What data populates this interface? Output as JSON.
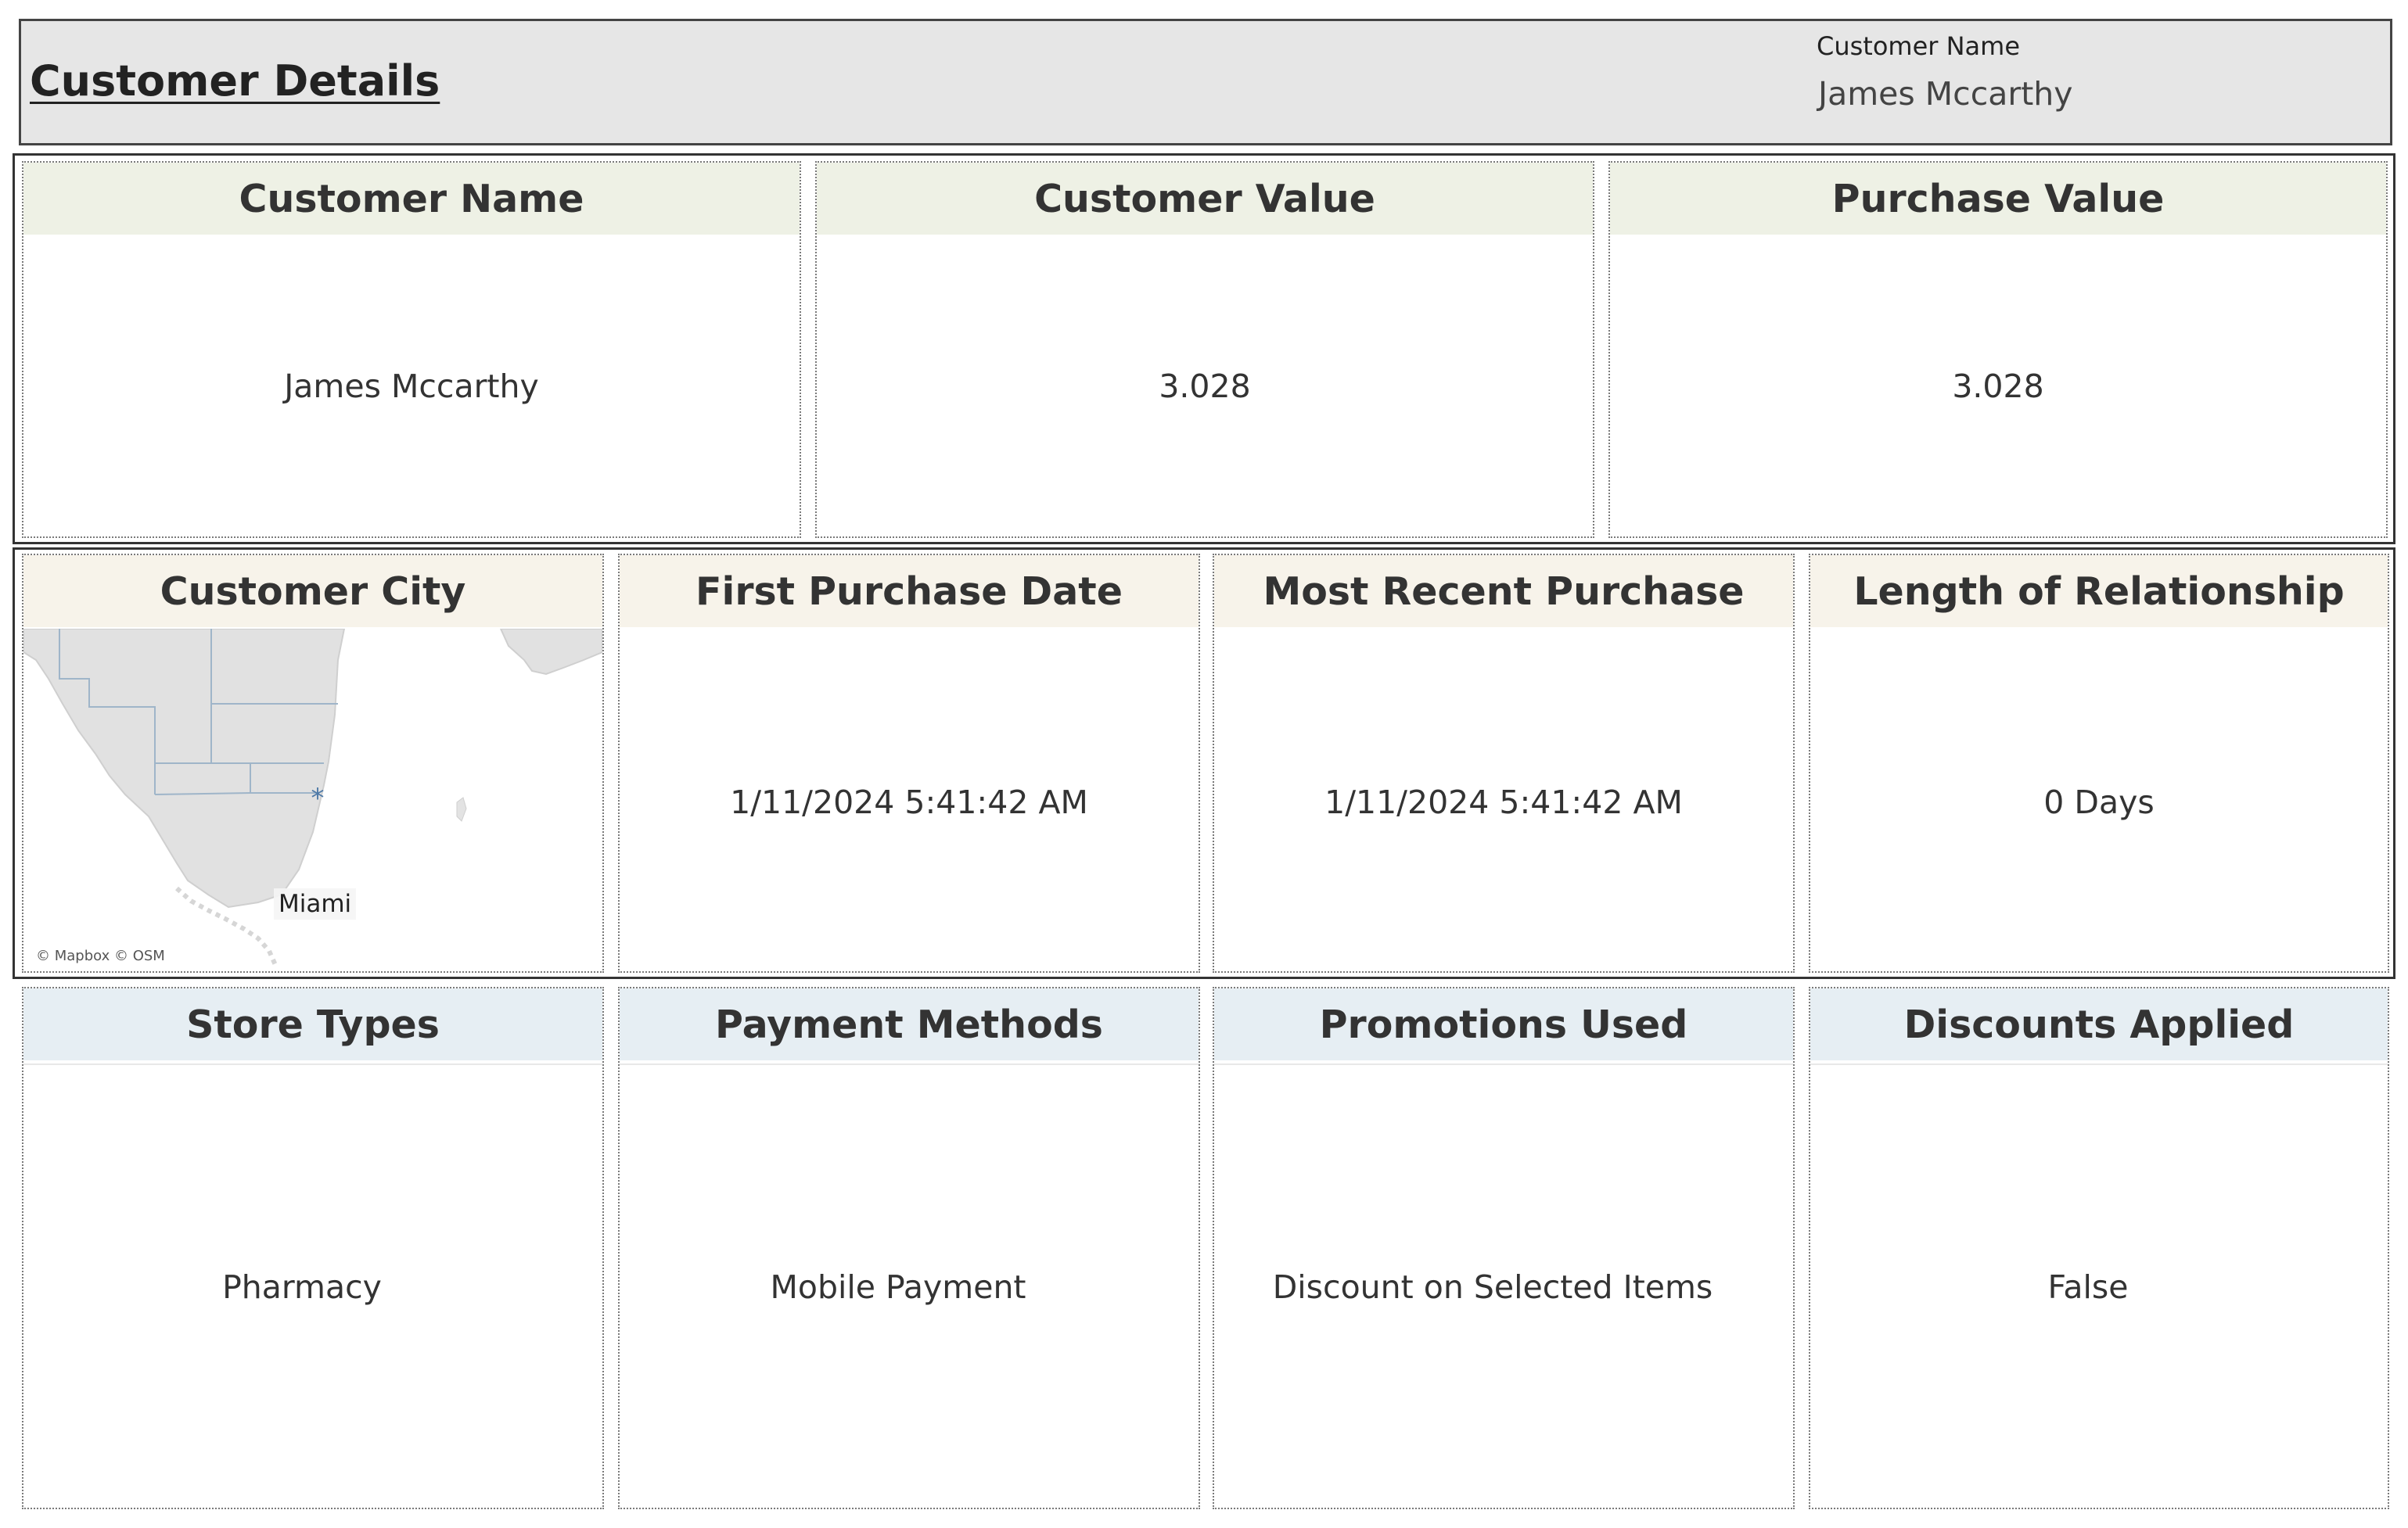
{
  "header": {
    "title": "Customer Details",
    "filter_label": "Customer Name",
    "filter_value": "James Mccarthy"
  },
  "row1": {
    "customer_name": {
      "label": "Customer Name",
      "value": "James Mccarthy"
    },
    "customer_value": {
      "label": "Customer Value",
      "value": "3.028"
    },
    "purchase_value": {
      "label": "Purchase Value",
      "value": "3.028"
    }
  },
  "row2": {
    "customer_city": {
      "label": "Customer City",
      "city": "Miami",
      "attribution": "© Mapbox © OSM"
    },
    "first_purchase": {
      "label": "First Purchase Date",
      "value": "1/11/2024 5:41:42 AM"
    },
    "recent_purchase": {
      "label": "Most Recent Purchase",
      "value": "1/11/2024 5:41:42 AM"
    },
    "length_relationship": {
      "label": "Length of Relationship",
      "value": "0 Days"
    }
  },
  "row3": {
    "store_types": {
      "label": "Store Types",
      "value": "Pharmacy"
    },
    "payment_methods": {
      "label": "Payment Methods",
      "value": "Mobile Payment"
    },
    "promotions_used": {
      "label": "Promotions Used",
      "value": "Discount on Selected Items"
    },
    "discounts_applied": {
      "label": "Discounts Applied",
      "value": "False"
    }
  },
  "colors": {
    "header_bg": "#e6e6e6",
    "green_header": "#eef1e5",
    "tan_header": "#f7f3ea",
    "blue_header": "#e6eef3",
    "map_marker": "#4e79a7"
  },
  "icons": {
    "map_marker": "asterisk-marker-icon"
  }
}
